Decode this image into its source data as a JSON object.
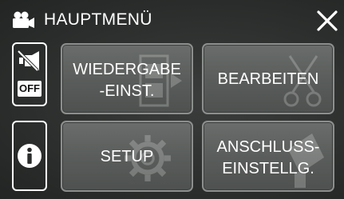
{
  "header": {
    "title": "HAUPTMENÜ",
    "mode_icon": "video-camera-icon",
    "close_icon": "close-icon"
  },
  "side": {
    "mute_icon": "speaker-mute-icon",
    "mute_badge": "OFF",
    "info_icon": "info-icon"
  },
  "menu": {
    "items": [
      {
        "label_line1": "WIEDERGABE",
        "label_line2": "-EINST.",
        "icon": "film-icon"
      },
      {
        "label_line1": "BEARBEITEN",
        "icon": "scissors-icon"
      },
      {
        "label_line1": "SETUP",
        "icon": "gear-icon"
      },
      {
        "label_line1": "ANSCHLUSS-",
        "label_line2": "EINSTELLG.",
        "icon": "connection-icon"
      }
    ]
  },
  "colors": {
    "background": "#2b2d2c",
    "button_fill": "#5a5d5b",
    "button_border": "#8c8f8d",
    "text": "#ffffff"
  }
}
